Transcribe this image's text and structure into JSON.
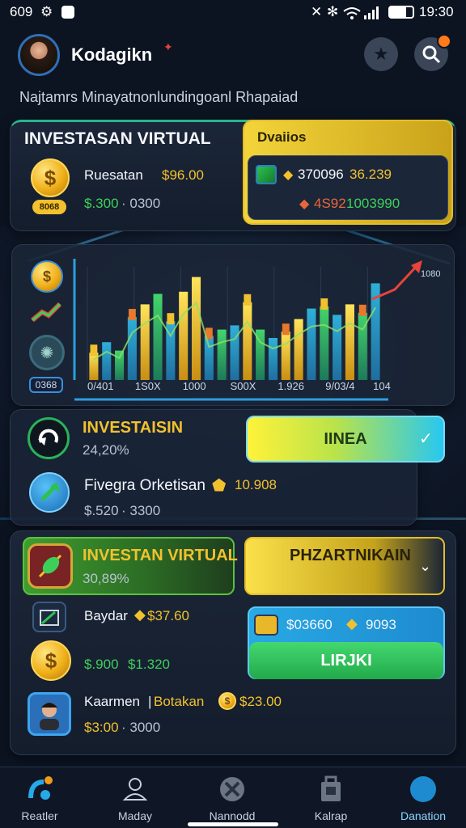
{
  "status_bar": {
    "left_text": "609",
    "time": "19:30"
  },
  "header": {
    "username": "Kodagikn",
    "subtitle": "Najtamrs Minayatnonlundingoanl Rhapaiad"
  },
  "summary_card": {
    "title": "INVESTASAN VIRTUAL",
    "row_label": "Ruesatan",
    "row_value": "$96.00",
    "sub_green": "$.300",
    "sub_white": "· 0300",
    "coin_badge": "8068"
  },
  "details_card": {
    "title": "Dvaiios",
    "value_1": "370096",
    "value_2": "36.239",
    "value_3": "4S92",
    "value_4": "1003990"
  },
  "chart_data": {
    "type": "bar",
    "categories": [
      "0/401",
      "1S0X",
      "1000",
      "S00X",
      "1.926",
      "9/03/4",
      "104"
    ],
    "left_badge": "0368",
    "trend_label": "1080",
    "series": [
      {
        "values": [
          1.3,
          1.8,
          1.4,
          3.0,
          3.6,
          4.1,
          2.8,
          4.2,
          4.9,
          2.1,
          2.4,
          2.6,
          3.7,
          2.4,
          2.0,
          2.3,
          2.9,
          3.4,
          3.5,
          3.1,
          3.6,
          3.2,
          4.6
        ]
      }
    ],
    "ylim": [
      0,
      5
    ],
    "grid": true
  },
  "invest_section": {
    "title": "INVESTAISIN",
    "percent": "24,20%",
    "action_label": "IINEA",
    "row_label": "Fivegra Orketisan",
    "row_value": "10.908",
    "sub_value": "$.520",
    "sub_value_2": "· 3300"
  },
  "portfolio_section": {
    "title": "INVESTAN VIRTUAL",
    "percent": "30,89%",
    "dropdown_label": "PHZARTNIKAIN",
    "row_1_label": "Baydar",
    "row_1_value": "$37.60",
    "box_value_1": "$03660",
    "box_value_2": "9093",
    "action_label": "LIRJKI",
    "row_2_green": "$.900",
    "row_2_white": "$1.320",
    "row_3_name": "Kaarmen",
    "row_3_tag": "Botakan",
    "row_3_value": "$23.00",
    "row_3_sub": "$3:00",
    "row_3_sub_2": "· 3000"
  },
  "tabs": [
    {
      "label": "Reatler",
      "icon": "chart-icon"
    },
    {
      "label": "Maday",
      "icon": "user-icon"
    },
    {
      "label": "Nannodd",
      "icon": "globe-icon"
    },
    {
      "label": "Kalrap",
      "icon": "bag-icon"
    },
    {
      "label": "Danation",
      "icon": "compass-icon"
    }
  ],
  "colors": {
    "accent": "#f2c12e",
    "positive": "#3ecf5b",
    "action_cyan": "#1ec6f0",
    "background": "#0c1422"
  }
}
